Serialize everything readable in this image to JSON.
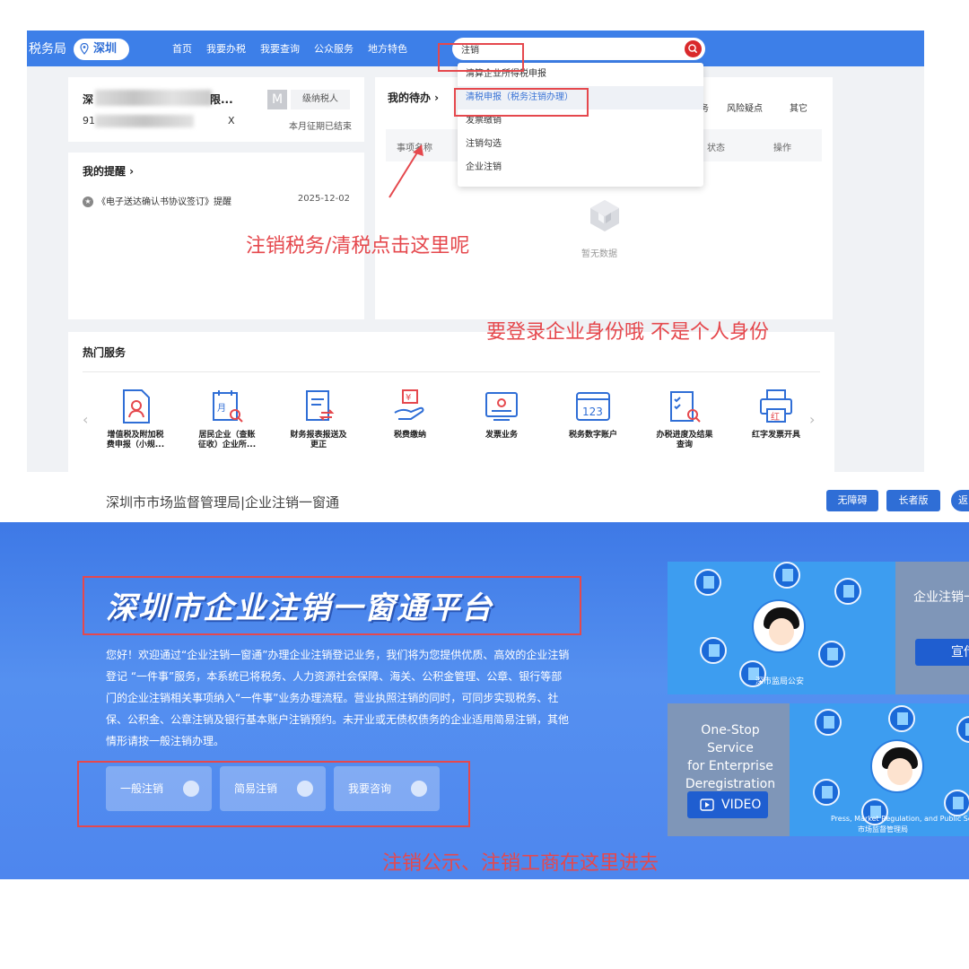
{
  "tax": {
    "brand": "税务局",
    "city": "深圳",
    "nav": [
      "首页",
      "我要办税",
      "我要查询",
      "公众服务",
      "地方特色"
    ],
    "search_value": "注销",
    "dropdown": [
      "清算企业所得税申报",
      "清税申报（税务注销办理）",
      "发票缴销",
      "注销勾选",
      "企业注销"
    ],
    "company": {
      "name_prefix": "深",
      "name_suffix": "限...",
      "id_prefix": "91",
      "id_suffix": "X",
      "badge": "M",
      "taxpayer_level": "级纳税人",
      "period_status": "本月征期已结束"
    },
    "reminders": {
      "title": "我的提醒 ›",
      "item": "《电子送达确认书协议签订》提醒",
      "date": "2025-12-02"
    },
    "todo": {
      "title": "我的待办 ›",
      "tab_partial": "务",
      "tabs": [
        "风险疑点",
        "其它"
      ],
      "columns": [
        "事项名称",
        "状态",
        "操作"
      ],
      "empty": "暂无数据"
    },
    "hot": {
      "title": "热门服务",
      "items": [
        "增值税及附加税\n费申报（小规...",
        "居民企业（查账\n征收）企业所...",
        "财务报表报送及\n更正",
        "税费缴纳",
        "发票业务",
        "税务数字账户",
        "办税进度及结果\n查询",
        "红字发票开具"
      ]
    }
  },
  "annotations": {
    "a1": "注销税务/清税点击这里呢",
    "a2": "要登录企业身份哦 不是个人身份",
    "a3": "注销公示、注销工商在这里进去"
  },
  "market": {
    "header_title": "深圳市市场监督管理局|企业注销一窗通",
    "header_buttons": [
      "无障碍",
      "长者版",
      "返"
    ],
    "banner_title": "深圳市企业注销一窗通平台",
    "intro": "您好！欢迎通过“企业注销一窗通”办理企业注销登记业务，我们将为您提供优质、高效的企业注销登记 “一件事”服务，本系统已将税务、人力资源社会保障、海关、公积金管理、公章、银行等部门的企业注销相关事项纳入“一件事”业务办理流程。营业执照注销的同时，可同步实现税务、社保、公积金、公章注销及银行基本账户注销预约。未开业或无债权债务的企业适用简易注销，其他情形请按一般注销办理。",
    "buttons": [
      "一般注销",
      "简易注销",
      "我要咨询"
    ],
    "tile_top_text": "企业注销一",
    "tile_top_btn": "宣传",
    "tile_bottom_text": "One-Stop Service\nfor Enterprise\nDeregistration",
    "video_label": "VIDEO",
    "caption_top": "深市监局公安",
    "caption_bottom": "Press, Market Regulation, and Public Security",
    "caption_bottom2": "市场监督管理局"
  },
  "colors": {
    "nav_blue": "#3d7fe8",
    "annotation_red": "#e5484d",
    "search_red": "#d9292b",
    "banner_blue": "#4a83ec"
  }
}
